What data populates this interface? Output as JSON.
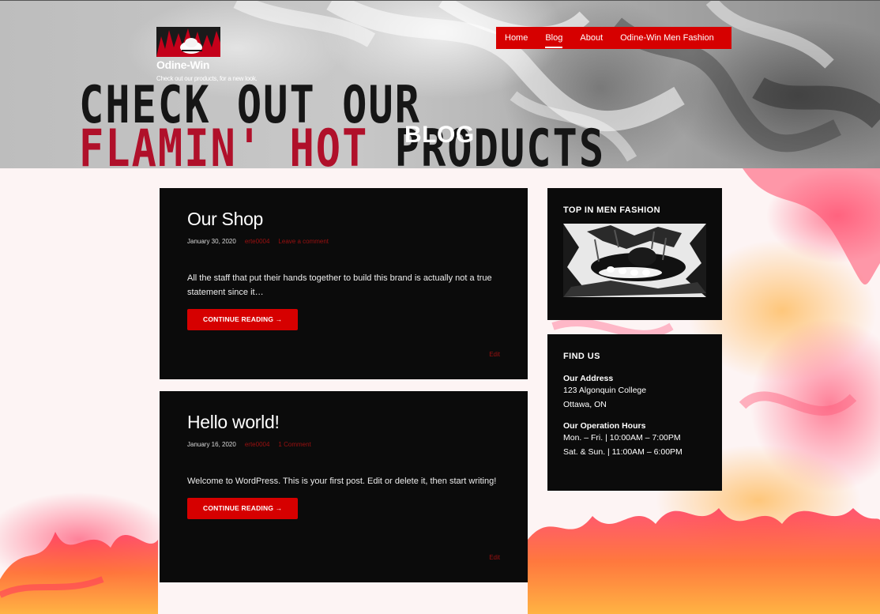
{
  "site": {
    "title": "Odine-Win",
    "tagline": "Check out our products, for a new look."
  },
  "nav": {
    "items": [
      {
        "label": "Home",
        "active": false
      },
      {
        "label": "Blog",
        "active": true
      },
      {
        "label": "About",
        "active": false
      },
      {
        "label": "Odine-Win Men Fashion",
        "active": false
      }
    ]
  },
  "hero": {
    "line1": "CHECK OUT OUR",
    "line2_red": "FLAMIN' HOT",
    "line2_dark": "PRODUCTS",
    "page_title": "BLOG"
  },
  "posts": [
    {
      "title": "Our Shop",
      "date": "January 30, 2020",
      "author": "erte0004",
      "comments": "Leave a comment",
      "excerpt": "All the staff that put their hands together to build this brand is actually not a true statement since it…",
      "read_more": "CONTINUE READING →",
      "edit": "Edit"
    },
    {
      "title": "Hello world!",
      "date": "January 16, 2020",
      "author": "erte0004",
      "comments": "1 Comment",
      "excerpt": "Welcome to WordPress. This is your first post. Edit or delete it, then start writing!",
      "read_more": "CONTINUE READING →",
      "edit": "Edit"
    }
  ],
  "sidebar": {
    "top_widget": {
      "title": "TOP IN MEN FASHION"
    },
    "find_us": {
      "title": "FIND US",
      "address_label": "Our Address",
      "address_line1": "123 Algonquin College",
      "address_line2": "Ottawa, ON",
      "hours_label": "Our Operation Hours",
      "hours_line1": "Mon. – Fri. | 10:00AM – 7:00PM",
      "hours_line2": "Sat. & Sun. | 11:00AM – 6:00PM"
    }
  },
  "colors": {
    "accent_red": "#d60000",
    "link_red": "#9c1010",
    "panel_black": "#0b0b0b"
  }
}
